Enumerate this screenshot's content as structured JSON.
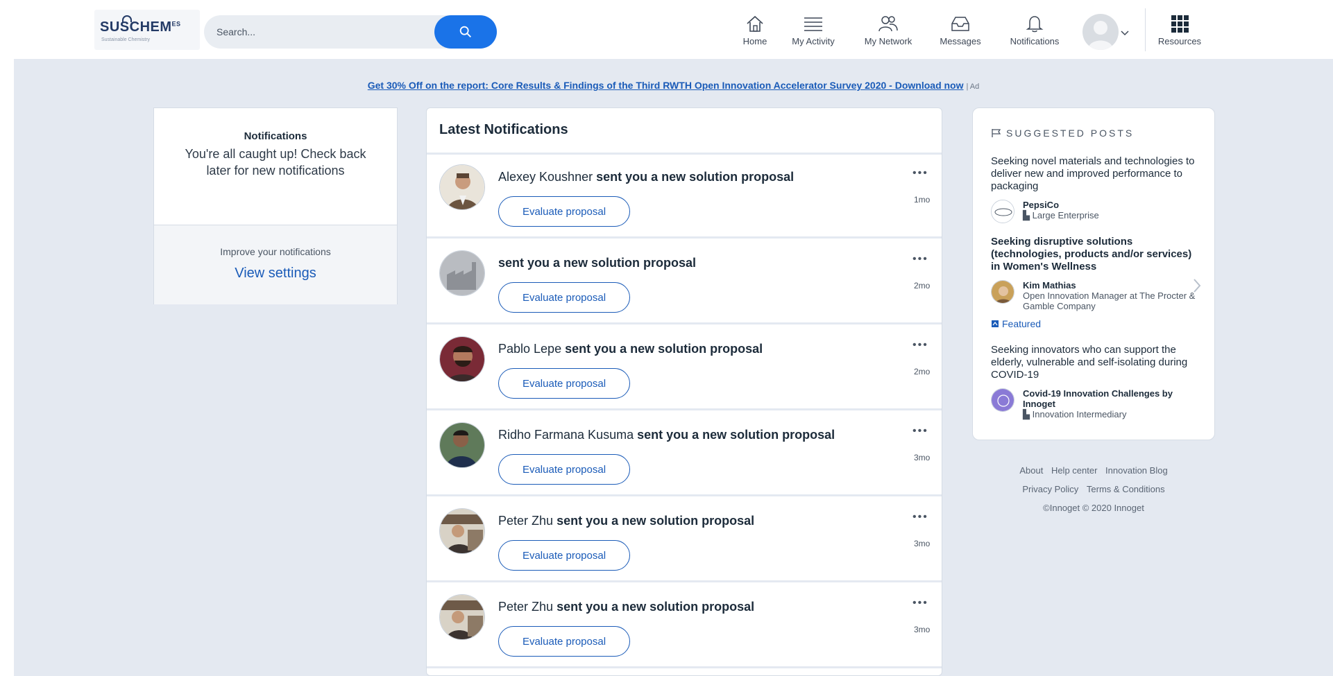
{
  "header": {
    "logo_text": "SUSCHEM",
    "logo_sup": "ES",
    "logo_sub": "Sustainable Chemistry",
    "search_placeholder": "Search...",
    "nav": [
      {
        "label": "Home",
        "icon": "home-icon"
      },
      {
        "label": "My Activity",
        "icon": "activity-icon"
      },
      {
        "label": "My Network",
        "icon": "network-icon"
      },
      {
        "label": "Messages",
        "icon": "messages-icon"
      },
      {
        "label": "Notifications",
        "icon": "bell-icon"
      }
    ],
    "resources_label": "Resources"
  },
  "ad": {
    "text": "Get 30% Off on the report: Core Results & Findings of the Third RWTH Open Innovation Accelerator Survey 2020 - Download now",
    "tag": "| Ad"
  },
  "left_panel": {
    "title": "Notifications",
    "message": "You're all caught up! Check back later for new notifications",
    "improve": "Improve your notifications",
    "settings_link": "View settings"
  },
  "feed": {
    "title": "Latest Notifications",
    "action_text": "sent you a new solution proposal",
    "button_label": "Evaluate proposal",
    "items": [
      {
        "name": "Alexey Koushner",
        "time": "1mo"
      },
      {
        "name": "",
        "time": "2mo"
      },
      {
        "name": "Pablo Lepe",
        "time": "2mo"
      },
      {
        "name": "Ridho Farmana Kusuma",
        "time": "3mo"
      },
      {
        "name": "Peter Zhu",
        "time": "3mo"
      },
      {
        "name": "Peter Zhu",
        "time": "3mo"
      }
    ]
  },
  "suggested": {
    "heading": "Suggested posts",
    "posts": [
      {
        "title": "Seeking novel materials and technologies to deliver new and improved performance to packaging",
        "author": "PepsiCo",
        "sub": "Large Enterprise"
      },
      {
        "title": "Seeking disruptive solutions (technologies, products and/or services) in Women's Wellness",
        "author": "Kim Mathias",
        "sub": "Open Innovation Manager at The Procter & Gamble Company",
        "featured": "Featured"
      },
      {
        "title": "Seeking innovators who can support the elderly, vulnerable and self-isolating during COVID-19",
        "author": "Covid-19 Innovation Challenges by Innoget",
        "sub": "Innovation Intermediary"
      }
    ]
  },
  "footer": {
    "links_row1": [
      "About",
      "Help center",
      "Innovation Blog"
    ],
    "links_row2": [
      "Privacy Policy",
      "Terms & Conditions"
    ],
    "copyright": "©Innoget © 2020 Innoget"
  },
  "colors": {
    "accent": "#1a73e8",
    "link": "#1a5bb8",
    "stage": "#e4e9f1"
  }
}
